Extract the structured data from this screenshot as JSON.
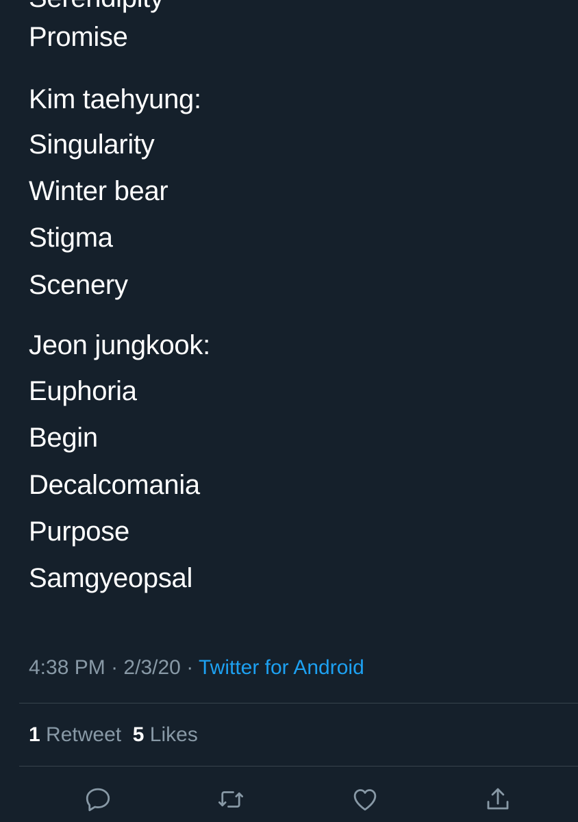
{
  "tweet": {
    "cut_off_line": "Serendipity",
    "lines": [
      "Promise",
      "Kim taehyung:",
      "Singularity",
      "Winter bear",
      "Stigma",
      "Scenery",
      "Jeon jungkook:",
      "Euphoria",
      "Begin",
      "Decalcomania",
      "Purpose",
      "Samgyeopsal"
    ]
  },
  "meta": {
    "time": "4:38 PM",
    "separator": "·",
    "date": "2/3/20",
    "source": "Twitter for Android"
  },
  "stats": {
    "retweets_count": "1",
    "retweets_label": "Retweet",
    "likes_count": "5",
    "likes_label": "Likes"
  },
  "actions": [
    "reply-icon",
    "retweet-icon",
    "like-icon",
    "share-icon"
  ],
  "colors": {
    "background": "#15202b",
    "text": "#ffffff",
    "secondary": "#8899a6",
    "link": "#1da1f2",
    "divider": "#38444d"
  }
}
